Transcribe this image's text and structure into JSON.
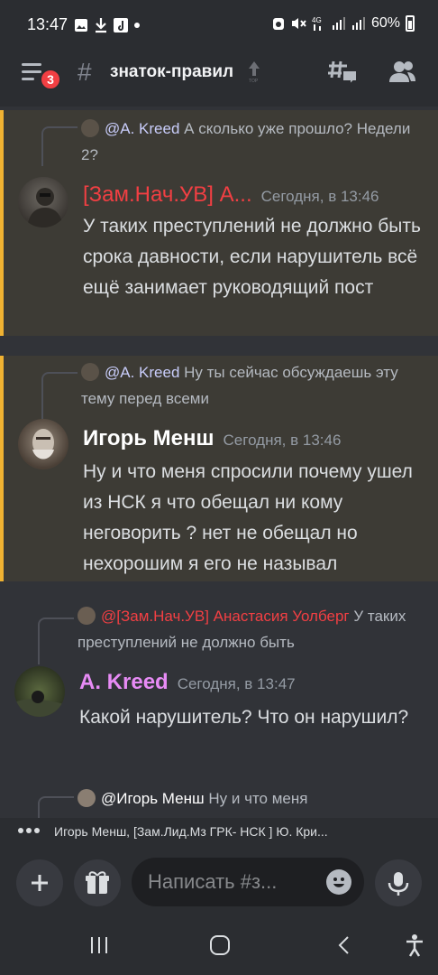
{
  "status_bar": {
    "time": "13:47",
    "battery": "60%"
  },
  "header": {
    "unread_badge": "3",
    "channel_name": "знаток-правил"
  },
  "messages": [
    {
      "reply_author": "@A. Kreed",
      "reply_text": "А сколько уже прошло? Недели 2?",
      "author": "[Зам.Нач.УВ] А...",
      "author_color": "#f23f43",
      "timestamp": "Сегодня, в 13:46",
      "text": "У таких преступлений не должно быть срока давности, если нарушитель всё ещё занимает руководящий пост"
    },
    {
      "reply_author": "@A. Kreed",
      "reply_text": "Ну ты сейчас обсуждаешь эту тему перед всеми",
      "author": "Игорь Менш",
      "author_color": "#ffffff",
      "timestamp": "Сегодня, в 13:46",
      "text": "Ну и что меня спросили почему ушел из НСК я что обещал ни кому неговорить ? нет не обещал но нехорошим я его не называл"
    },
    {
      "reply_author": "@[Зам.Нач.УВ] Анастасия Уолберг",
      "reply_text": "У таких преступлений не должно быть",
      "author": "A. Kreed",
      "author_color": "#e78bf5",
      "timestamp": "Сегодня, в 13:47",
      "text": "Какой нарушитель? Что он нарушил?"
    },
    {
      "reply_author": "@Игорь Менш",
      "reply_text": "Ну и что меня"
    }
  ],
  "typing": {
    "text": "Игорь Менш, [Зам.Лид.Мз ГРК- НСК ] Ю. Кри..."
  },
  "composer": {
    "placeholder": "Написать #з..."
  },
  "colors": {
    "highlight_border": "#f0b232",
    "mention": "#c9cdfb",
    "red_name": "#f23f43",
    "pink_name": "#e78bf5"
  }
}
